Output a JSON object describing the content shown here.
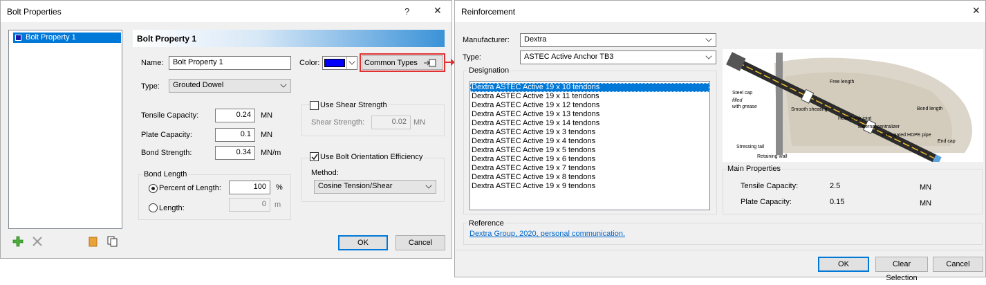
{
  "bolt_dialog": {
    "title": "Bolt Properties",
    "help": "?",
    "close": "✕",
    "list_item": "Bolt Property 1",
    "header": "Bolt Property 1",
    "name_label": "Name:",
    "name_value": "Bolt Property 1",
    "color_label": "Color:",
    "color_value": "#0000ff",
    "common_types_label": "Common Types",
    "type_label": "Type:",
    "type_value": "Grouted Dowel",
    "tensile_label": "Tensile Capacity:",
    "tensile_value": "0.24",
    "tensile_unit": "MN",
    "plate_label": "Plate Capacity:",
    "plate_value": "0.1",
    "plate_unit": "MN",
    "bond_label": "Bond Strength:",
    "bond_value": "0.34",
    "bond_unit": "MN/m",
    "bond_length_group": "Bond Length",
    "percent_label": "Percent of Length:",
    "percent_value": "100",
    "percent_unit": "%",
    "length_label": "Length:",
    "length_value": "0",
    "length_unit": "m",
    "use_shear_label": "Use Shear Strength",
    "shear_label": "Shear Strength:",
    "shear_value": "0.02",
    "shear_unit": "MN",
    "use_orientation_label": "Use Bolt Orientation Efficiency",
    "method_label": "Method:",
    "method_value": "Cosine Tension/Shear",
    "ok": "OK",
    "cancel": "Cancel"
  },
  "reinforcement_dialog": {
    "title": "Reinforcement",
    "close": "✕",
    "manufacturer_label": "Manufacturer:",
    "manufacturer_value": "Dextra",
    "type_label": "Type:",
    "type_value": "ASTEC Active Anchor TB3",
    "designation_label": "Designation",
    "designations": [
      "Dextra ASTEC Active 19 x 10 tendons",
      "Dextra ASTEC Active 19 x 11 tendons",
      "Dextra ASTEC Active 19 x 12 tendons",
      "Dextra ASTEC Active 19 x 13 tendons",
      "Dextra ASTEC Active 19 x 14 tendons",
      "Dextra ASTEC Active 19 x 3 tendons",
      "Dextra ASTEC Active 19 x 4 tendons",
      "Dextra ASTEC Active 19 x 5 tendons",
      "Dextra ASTEC Active 19 x 6 tendons",
      "Dextra ASTEC Active 19 x 7 tendons",
      "Dextra ASTEC Active 19 x 8 tendons",
      "Dextra ASTEC Active 19 x 9 tendons"
    ],
    "diagram_labels": {
      "steel_cap": "Steel cap",
      "filled": "filled",
      "with_grease": "with grease",
      "free_length": "Free length",
      "smooth_sheating": "Smooth sheating",
      "bond_length": "Bond length",
      "heatshrink_joint": "Heatshrink joint",
      "external_centralizer": "External centralizer",
      "corrugated_hdpe_pipe": "Corrugated HDPE pipe",
      "end_cap": "End cap",
      "stressing_tail": "Stressing tail",
      "retaining_wall": "Retaining wall"
    },
    "main_properties_label": "Main Properties",
    "tensile_label": "Tensile Capacity:",
    "tensile_value": "2.5",
    "tensile_unit": "MN",
    "plate_label": "Plate Capacity:",
    "plate_value": "0.15",
    "plate_unit": "MN",
    "reference_label": "Reference",
    "reference_link": "Dextra Group, 2020, personal communication.",
    "ok": "OK",
    "clear_selection": "Clear Selection",
    "cancel": "Cancel"
  },
  "colors": {
    "highlight_box": "#e03030",
    "selection": "#0078d7",
    "link": "#0066cc"
  }
}
